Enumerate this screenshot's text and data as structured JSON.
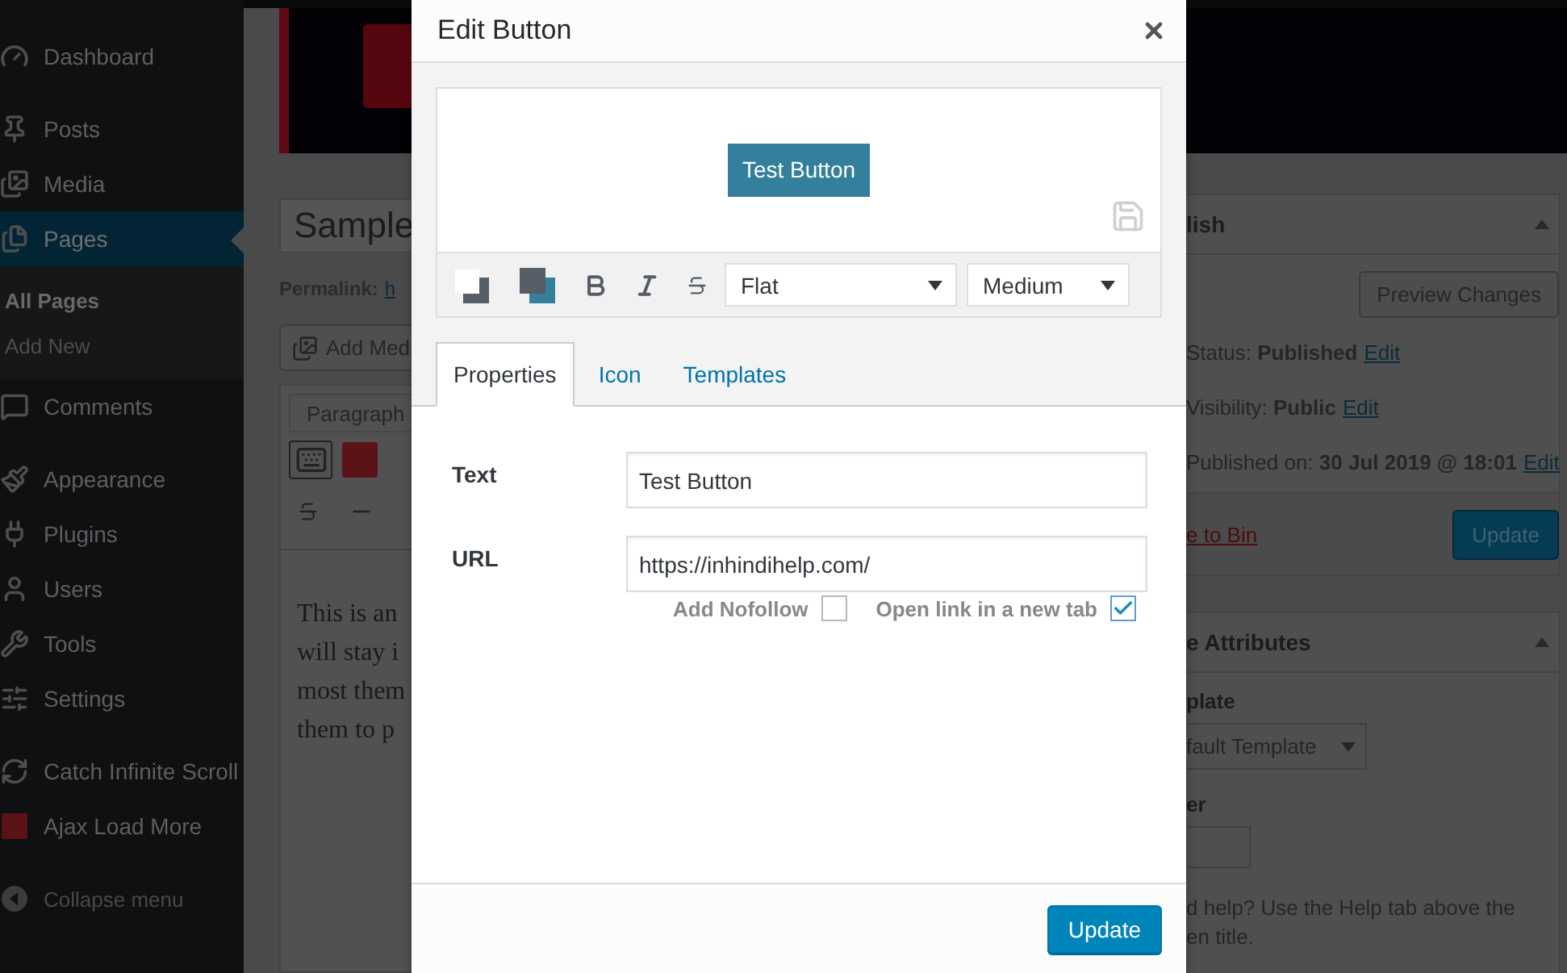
{
  "sidebar": {
    "groups": [
      {
        "items": [
          {
            "label": "Dashboard",
            "selected": false
          }
        ]
      },
      {
        "items": [
          {
            "label": "Posts",
            "selected": false
          },
          {
            "label": "Media",
            "selected": false
          },
          {
            "label": "Pages",
            "selected": true,
            "children": [
              {
                "label": "All Pages",
                "selected": true
              },
              {
                "label": "Add New",
                "selected": false
              }
            ]
          },
          {
            "label": "Comments",
            "selected": false
          }
        ]
      },
      {
        "items": [
          {
            "label": "Appearance",
            "selected": false
          },
          {
            "label": "Plugins",
            "selected": false
          },
          {
            "label": "Users",
            "selected": false
          },
          {
            "label": "Tools",
            "selected": false
          },
          {
            "label": "Settings",
            "selected": false
          }
        ]
      },
      {
        "items": [
          {
            "label": "Catch Infinite Scroll",
            "selected": false
          },
          {
            "label": "Ajax Load More",
            "selected": false
          }
        ]
      }
    ],
    "collapse": "Collapse menu"
  },
  "editor": {
    "title": "Sample",
    "permalink_label": "Permalink:",
    "permalink_link": "h",
    "add_media": "Add Med",
    "format_select": "Paragraph",
    "content_lines": [
      "This is an",
      "will stay i",
      "most them",
      "them to p"
    ]
  },
  "publish_panel": {
    "title": "lish",
    "preview_button": "Preview Changes",
    "meta": [
      {
        "label": "Status:",
        "value": "Published",
        "link": "Edit"
      },
      {
        "label": "Visibility:",
        "value": "Public",
        "link": "Edit"
      },
      {
        "label": "Published on:",
        "value": "30 Jul 2019 @ 18:01",
        "link": "Edit"
      }
    ],
    "trash_link": "e to Bin",
    "update_button": "Update"
  },
  "attributes_panel": {
    "title": "e Attributes",
    "template_label": "plate",
    "template_select": "fault Template",
    "order_label": "er",
    "help_lines": [
      "d help? Use the Help tab above the",
      "en title."
    ]
  },
  "modal": {
    "title": "Edit Button",
    "preview_button": "Test Button",
    "style_select": "Flat",
    "size_select": "Medium",
    "tabs": [
      {
        "label": "Properties",
        "selected": true
      },
      {
        "label": "Icon",
        "selected": false
      },
      {
        "label": "Templates",
        "selected": false
      }
    ],
    "fields": [
      {
        "label": "Text",
        "value": "Test Button"
      },
      {
        "label": "URL",
        "value": "https://inhindihelp.com/"
      }
    ],
    "options": [
      {
        "label": "Add Nofollow",
        "checked": false
      },
      {
        "label": "Open link in a new tab",
        "checked": true
      }
    ],
    "footer_button": "Update"
  }
}
